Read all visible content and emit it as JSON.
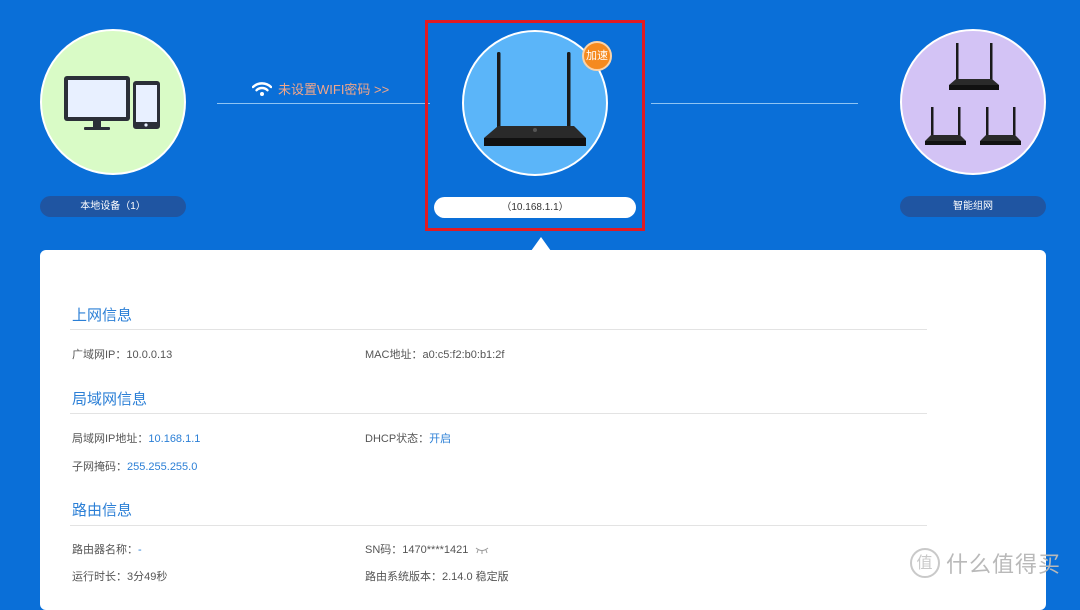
{
  "topology": {
    "local_devices_label": "本地设备（1）",
    "wifi_link_label": "未设置WIFI密码 >>",
    "router_ip_label": "（10.168.1.1）",
    "speed_badge": "加速",
    "mesh_label": "智能组网"
  },
  "sections": {
    "wan": {
      "title": "上网信息",
      "wan_ip_label": "广域网IP：",
      "wan_ip_value": "10.0.0.13",
      "mac_label": "MAC地址：",
      "mac_value": "a0:c5:f2:b0:b1:2f"
    },
    "lan": {
      "title": "局域网信息",
      "lan_ip_label": "局域网IP地址：",
      "lan_ip_value": "10.168.1.1",
      "dhcp_label": "DHCP状态：",
      "dhcp_value": "开启",
      "mask_label": "子网掩码：",
      "mask_value": "255.255.255.0"
    },
    "router": {
      "title": "路由信息",
      "name_label": "路由器名称：",
      "name_value": "-",
      "sn_label": "SN码：",
      "sn_value": "1470****1421",
      "uptime_label": "运行时长：",
      "uptime_value": "3分49秒",
      "version_label": "路由系统版本：",
      "version_value": "2.14.0 稳定版"
    }
  },
  "watermark": {
    "logo_char": "值",
    "text": "什么值得买"
  },
  "colors": {
    "background": "#0a6fd8",
    "accent_text": "#2b7fd6",
    "selection_border": "#e01a22",
    "badge": "#f58a1f"
  }
}
